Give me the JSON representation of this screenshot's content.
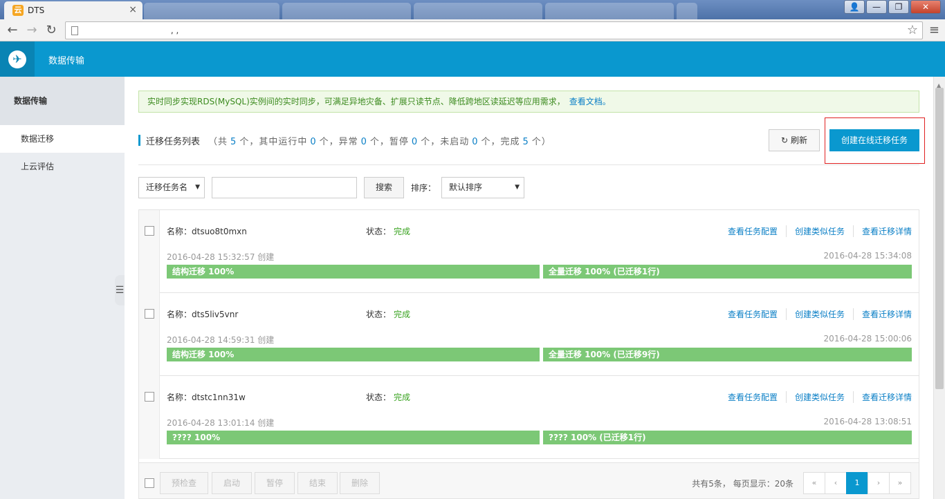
{
  "browser": {
    "tab_title": "DTS",
    "tab_favicon": "云",
    "tab_close": "×",
    "url": "                                 , ,",
    "window_buttons": [
      "👤",
      "—",
      "❐",
      "✕"
    ]
  },
  "header": {
    "app_title": "数据传输",
    "logo_icon": "cloud-logo"
  },
  "sidebar": {
    "heading": "数据传输",
    "items": [
      {
        "label": "数据迁移",
        "active": true
      },
      {
        "label": "上云评估",
        "active": false
      }
    ]
  },
  "notice": {
    "text": "实时同步实现RDS(MySQL)实例间的实时同步，可满足异地灾备、扩展只读节点、降低跨地区读延迟等应用需求，",
    "link": "查看文档。"
  },
  "list": {
    "title": "迁移任务列表",
    "stats": {
      "prefix": "（共",
      "total": "5",
      "running_label": "个，其中运行中",
      "running": "0",
      "error_label": "个，异常",
      "error": "0",
      "paused_label": "个，暂停",
      "paused": "0",
      "notstarted_label": "个，未启动",
      "notstarted": "0",
      "done_label": "个，完成",
      "done": "5",
      "suffix": "个）"
    },
    "refresh_label": "刷新",
    "create_label": "创建在线迁移任务"
  },
  "filter": {
    "field_select": "迁移任务名",
    "search_button": "搜索",
    "sort_label": "排序：",
    "sort_select": "默认排序"
  },
  "tasks": [
    {
      "name": "名称：dtsuo8t0mxn",
      "status_label": "状态：",
      "status": "完成",
      "links": [
        "查看任务配置",
        "创建类似任务",
        "查看迁移详情"
      ],
      "created": "2016-04-28 15:32:57 创建",
      "finished": "2016-04-28 15:34:08",
      "progress_left": {
        "label": "结构迁移  100%",
        "value": 1.0
      },
      "progress_right": {
        "label": "全量迁移  100% (已迁移1行)",
        "value": 1.0
      }
    },
    {
      "name": "名称：dts5liv5vnr",
      "status_label": "状态：",
      "status": "完成",
      "links": [
        "查看任务配置",
        "创建类似任务",
        "查看迁移详情"
      ],
      "created": "2016-04-28 14:59:31 创建",
      "finished": "2016-04-28 15:00:06",
      "progress_left": {
        "label": "结构迁移  100%",
        "value": 1.0
      },
      "progress_right": {
        "label": "全量迁移  100% (已迁移9行)",
        "value": 1.0
      }
    },
    {
      "name": "名称：dtstc1nn31w",
      "status_label": "状态：",
      "status": "完成",
      "links": [
        "查看任务配置",
        "创建类似任务",
        "查看迁移详情"
      ],
      "created": "2016-04-28 13:01:14 创建",
      "finished": "2016-04-28 13:08:51",
      "progress_left": {
        "label": "????  100%",
        "value": 1.0
      },
      "progress_right": {
        "label": "????  100% (已迁移1行)",
        "value": 1.0
      }
    }
  ],
  "footer": {
    "buttons": [
      "预检查",
      "启动",
      "暂停",
      "结束",
      "删除"
    ],
    "page_info": "共有5条， 每页显示：20条",
    "pager": [
      "«",
      "‹",
      "1",
      "›",
      "»"
    ]
  },
  "colors": {
    "brand": "#0a98cf",
    "success": "#3aa321",
    "progress_fill": "#7cc876",
    "link": "#0a7fc6"
  }
}
